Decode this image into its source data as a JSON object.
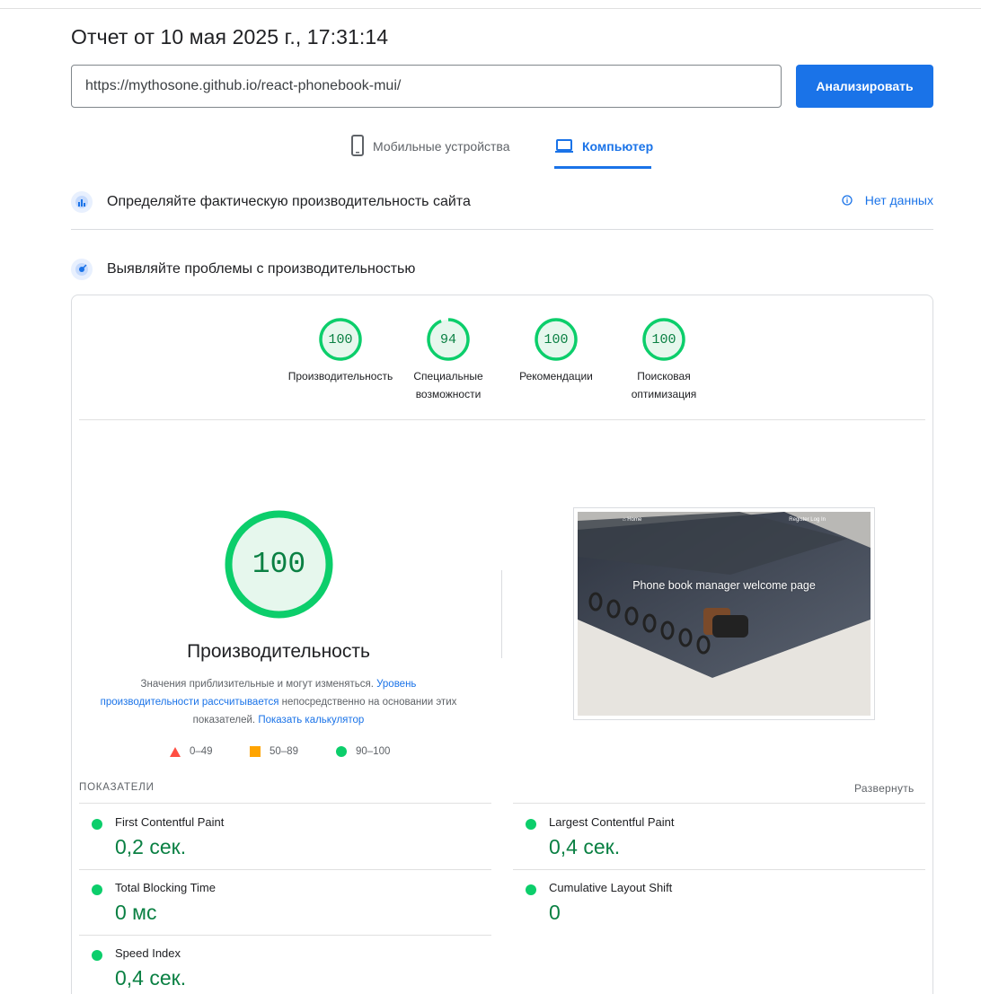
{
  "report": {
    "title": "Отчет от 10 мая 2025 г., 17:31:14",
    "url_value": "https://mythosone.github.io/react-phonebook-mui/",
    "analyze_label": "Анализировать"
  },
  "tabs": [
    {
      "label": "Мобильные устройства",
      "icon": "phone-icon",
      "active": false
    },
    {
      "label": "Компьютер",
      "icon": "laptop-icon",
      "active": true
    }
  ],
  "field_data": {
    "title": "Определяйте фактическую производительность сайта",
    "status": "Нет данных"
  },
  "lab": {
    "title": "Выявляйте проблемы с производительностью"
  },
  "scores": [
    {
      "value": "100",
      "label_line1": "Производительность",
      "label_line2": "",
      "fraction": 1.0
    },
    {
      "value": "94",
      "label_line1": "Специальные",
      "label_line2": "возможности",
      "fraction": 0.94
    },
    {
      "value": "100",
      "label_line1": "Рекомендации",
      "label_line2": "",
      "fraction": 1.0
    },
    {
      "value": "100",
      "label_line1": "Поисковая",
      "label_line2": "оптимизация",
      "fraction": 1.0
    }
  ],
  "performance": {
    "score": "100",
    "title": "Производительность",
    "desc_text1": "Значения приблизительные и могут изменяться.",
    "desc_link1": "Уровень производительности рассчитывается",
    "desc_text2": "непосредственно на основании этих показателей.",
    "desc_link2": "Показать калькулятор"
  },
  "legend": [
    {
      "range": "0–49",
      "color": "#ff4e42",
      "shape": "triangle"
    },
    {
      "range": "50–89",
      "color": "#ffa400",
      "shape": "square"
    },
    {
      "range": "90–100",
      "color": "#0cce6b",
      "shape": "circle"
    }
  ],
  "screenshot": {
    "nav_left": "⌂ Home",
    "nav_right": "Register   Log In",
    "caption": "Phone book manager welcome page"
  },
  "metrics": {
    "header": "ПОКАЗАТЕЛИ",
    "expand_label": "Развернуть",
    "items": [
      {
        "name": "First Contentful Paint",
        "value": "0,2 сек."
      },
      {
        "name": "Largest Contentful Paint",
        "value": "0,4 сек."
      },
      {
        "name": "Total Blocking Time",
        "value": "0 мс"
      },
      {
        "name": "Cumulative Layout Shift",
        "value": "0"
      },
      {
        "name": "Speed Index",
        "value": "0,4 сек."
      }
    ]
  },
  "colors": {
    "accent": "#1a73e8",
    "pass": "#0cce6b",
    "pass_text": "#0a8043"
  }
}
